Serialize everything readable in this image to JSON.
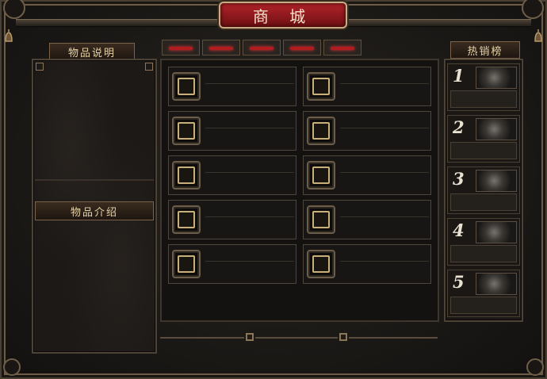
{
  "title": "商 城",
  "left_panel": {
    "header": "物品说明",
    "mid_label": "物品介绍"
  },
  "tabs": [
    "",
    "",
    "",
    "",
    ""
  ],
  "items": [
    {
      "name": ""
    },
    {
      "name": ""
    },
    {
      "name": ""
    },
    {
      "name": ""
    },
    {
      "name": ""
    },
    {
      "name": ""
    },
    {
      "name": ""
    },
    {
      "name": ""
    },
    {
      "name": ""
    },
    {
      "name": ""
    }
  ],
  "hot": {
    "header": "热销榜",
    "ranks": [
      "1",
      "2",
      "3",
      "4",
      "5"
    ]
  },
  "colors": {
    "title_red": "#b3242a",
    "accent_gold": "#c8b07a",
    "tab_red": "#b31c1f"
  },
  "icons": {
    "bell": "bell-icon",
    "knot": "knot-ornament-icon"
  }
}
